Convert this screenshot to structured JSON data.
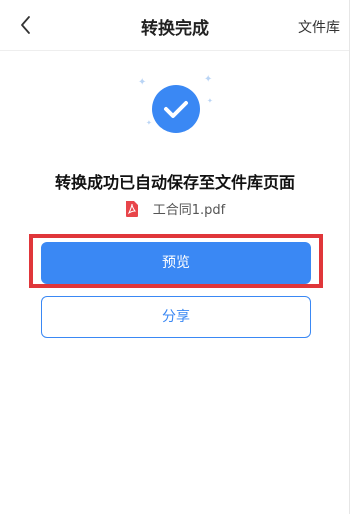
{
  "header": {
    "title": "转换完成",
    "right_link": "文件库"
  },
  "main": {
    "success_message": "转换成功已自动保存至文件库页面",
    "file_name": "工合同1.pdf",
    "preview_label": "预览",
    "share_label": "分享"
  },
  "colors": {
    "accent": "#3a88f4",
    "highlight_border": "#e0363a",
    "pdf_icon": "#e8454a"
  },
  "icons": {
    "back": "chevron-left-icon",
    "success": "check-circle-icon",
    "file": "pdf-file-icon"
  }
}
